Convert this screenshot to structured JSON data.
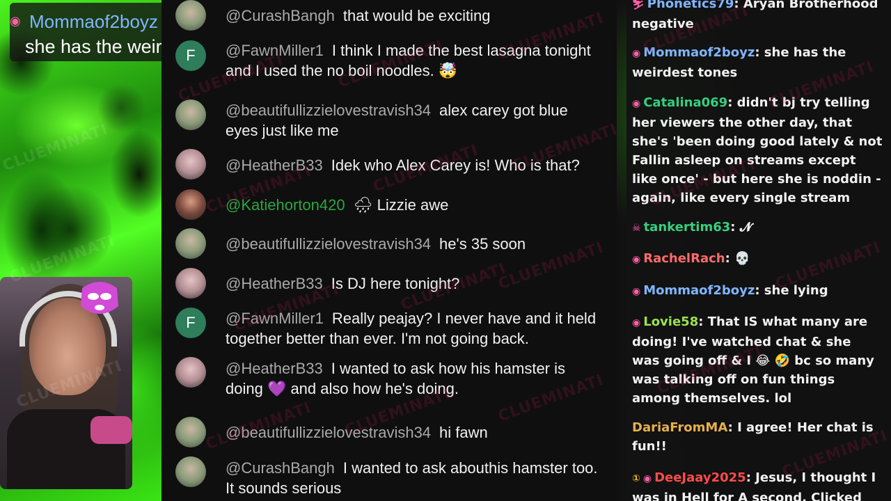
{
  "overlay": {
    "username": "Mommaof2boyz",
    "message": "she has the weirdest tones"
  },
  "watermark": "CLUEMINATI",
  "youtube_chat": [
    {
      "user": "@CurashBangh",
      "text": "that would be exciting",
      "avatar": "photo"
    },
    {
      "user": "@FawnMiller1",
      "text": "I think I made the best lasagna tonight and I used the no boil noodles. 🤯",
      "avatar": "F"
    },
    {
      "user": "@beautifullizzielovestravish34",
      "text": "alex carey got blue eyes just like me",
      "avatar": "photo"
    },
    {
      "user": "@HeatherB33",
      "text": "Idek who Alex Carey is! Who is that?",
      "avatar": "photo"
    },
    {
      "user": "@Katiehorton420",
      "text": "🌧 Lizzie awe",
      "avatar": "photo",
      "member": true
    },
    {
      "user": "@beautifullizzielovestravish34",
      "text": "he's 35 soon",
      "avatar": "photo"
    },
    {
      "user": "@HeatherB33",
      "text": "Is DJ here tonight?",
      "avatar": "photo"
    },
    {
      "user": "@FawnMiller1",
      "text": "Really peajay? I never have and it held together better than ever. I'm not going back.",
      "avatar": "F"
    },
    {
      "user": "@HeatherB33",
      "text": "I wanted to ask how his hamster is doing 💜 and also how he's doing.",
      "avatar": "photo"
    },
    {
      "user": "@beautifullizzielovestravish34",
      "text": "hi fawn",
      "avatar": "photo"
    },
    {
      "user": "@CurashBangh",
      "text": "I wanted to ask abouthis hamster too. It sounds serious",
      "avatar": "photo"
    }
  ],
  "twitch_chat": [
    {
      "user": "Phonetics79",
      "text": ": Aryan Brotherhood negative",
      "color": "#7fb6ff"
    },
    {
      "user": "Mommaof2boyz",
      "text": ": she has the weirdest tones",
      "color": "#7fb6ff"
    },
    {
      "user": "Catalina069",
      "text": ": didn't bj try telling her viewers the other day, that she's 'been doing good lately & not Fallin asleep on streams except like once' - but here she is noddin - again, like every single stream",
      "color": "#35d07f"
    },
    {
      "user": "tankertim63",
      "text": ": 𝓝",
      "color": "#35d07f"
    },
    {
      "user": "RachelRach",
      "text": ": 💀",
      "color": "#ff6b6b"
    },
    {
      "user": "Mommaof2boyz",
      "text": ": she lying",
      "color": "#7fb6ff"
    },
    {
      "user": "Lovie58",
      "text": ": That IS what many are doing! I've watched chat & she was going off & I 😂 🤣 bc so many was talking off on fun things among themselves. lol",
      "color": "#9be24c"
    },
    {
      "user": "DariaFromMA",
      "text": ": I agree! Her chat is fun!!",
      "color": "#e8b04a"
    },
    {
      "user": "DeeJaay2025",
      "text": ": Jesus, I thought I was in Hell for A second. Clicked on to",
      "color": "#ff4b4b"
    }
  ]
}
